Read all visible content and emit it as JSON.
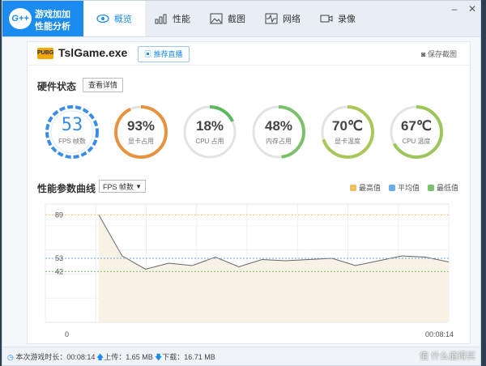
{
  "app": {
    "brand_line1": "游戏加加",
    "brand_line2": "性能分析",
    "badge": "G++"
  },
  "tabs": [
    {
      "label": "概览",
      "icon": "eye-icon",
      "active": true
    },
    {
      "label": "性能",
      "icon": "bar-chart-icon",
      "active": false
    },
    {
      "label": "截图",
      "icon": "image-icon",
      "active": false
    },
    {
      "label": "网络",
      "icon": "pulse-icon",
      "active": false
    },
    {
      "label": "录像",
      "icon": "video-icon",
      "active": false
    }
  ],
  "game": {
    "icon_text": "PUBG",
    "name": "TslGame.exe",
    "live_button": "推荐直播",
    "save_screenshot": "保存截图"
  },
  "hardware": {
    "title": "硬件状态",
    "details_button": "查看详情",
    "gauges": [
      {
        "value": "53",
        "label": "FPS 帧数",
        "fraction": null,
        "color": "#3a8ee6"
      },
      {
        "value": "93%",
        "label": "显卡占用",
        "fraction": 0.93,
        "color": "#e8913f"
      },
      {
        "value": "18%",
        "label": "CPU 占用",
        "fraction": 0.18,
        "color": "#5cb85c"
      },
      {
        "value": "48%",
        "label": "内存占用",
        "fraction": 0.48,
        "color": "#7cc06a"
      },
      {
        "value": "70℃",
        "label": "显卡温度",
        "fraction": 0.7,
        "color": "#a9c85a"
      },
      {
        "value": "67℃",
        "label": "CPU 温度",
        "fraction": 0.67,
        "color": "#9cc65a"
      }
    ]
  },
  "curve": {
    "title": "性能参数曲线",
    "metric_select": "FPS 帧数",
    "legend": [
      {
        "label": "最高值",
        "color": "#f0c060"
      },
      {
        "label": "平均值",
        "color": "#6aaee8"
      },
      {
        "label": "最低值",
        "color": "#7cc06a"
      }
    ]
  },
  "chart_data": {
    "type": "area",
    "x_start_label": "0",
    "x_end_label": "00:08:14",
    "y_ticks": [
      "89",
      "53",
      "42"
    ],
    "ylim": [
      0,
      98
    ],
    "max": 89,
    "avg": 53,
    "min": 42,
    "values": [
      89,
      55,
      44,
      49,
      47,
      54,
      46,
      52,
      51,
      52,
      53,
      47,
      51,
      55,
      54,
      50
    ]
  },
  "status": {
    "duration_label": "本次游戏时长：",
    "duration": "00:08:14",
    "upload_label": "上传：",
    "upload": "1.65 MB",
    "download_label": "下载：",
    "download": "16.71 MB",
    "watermark": "值 什么值得买"
  }
}
